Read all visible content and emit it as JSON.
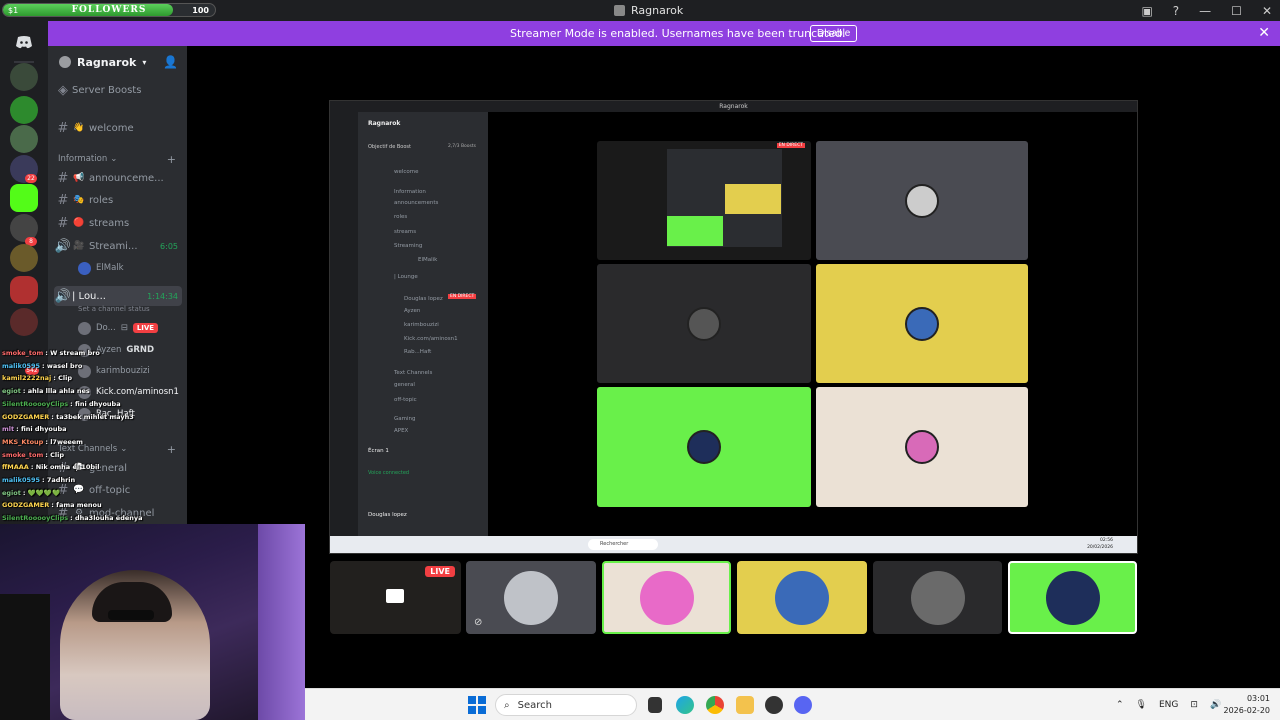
{
  "overlay": {
    "followers_start": "$1",
    "followers_label": "FOLLOWERS",
    "followers_count": "100",
    "followers_progress": 0.8
  },
  "window": {
    "title": "Ragnarok",
    "icons": [
      "mention-icon",
      "help-icon",
      "minimize-icon",
      "maximize-icon",
      "close-icon"
    ]
  },
  "banner": {
    "text": "Streamer Mode is enabled. Usernames have been truncated.",
    "button": "Disable",
    "color": "#8f3fe0"
  },
  "rail": {
    "badges": [
      "22",
      "8",
      "542"
    ]
  },
  "sidebar": {
    "server_name": "Ragnarok",
    "boosts": "Server Boosts",
    "channels": [
      {
        "name": "welcome",
        "emoji": "👋"
      },
      {
        "name": "announceme...",
        "emoji": "📢"
      },
      {
        "name": "roles",
        "emoji": "🎭"
      },
      {
        "name": "streams",
        "emoji": "🔴"
      },
      {
        "name": "Streami...",
        "emoji": "🎥",
        "voice": true,
        "timer": "6:05"
      }
    ],
    "category_info": "Information",
    "streaming_user": "ElMalk",
    "lounge": {
      "name": "| Lou...",
      "timer": "1:14:34",
      "status": "Set a channel status"
    },
    "voice_users": [
      {
        "name": "Do...",
        "live": "LIVE"
      },
      {
        "name": "Ayzen",
        "tag": "GRND"
      },
      {
        "name": "karimbouzizi"
      },
      {
        "name": "Kick.com/aminosn1"
      },
      {
        "name": "Rac..Haft"
      }
    ],
    "category_text": "Text Channels",
    "text_channels": [
      "general",
      "off-topic",
      "mod-channel"
    ]
  },
  "chat": [
    {
      "user": "smoke_tom",
      "text": ": W stream bro",
      "color": "#ff6b6b"
    },
    {
      "user": "malik0595",
      "text": ": wasel bro",
      "color": "#4fc3f7"
    },
    {
      "user": "kamil2222naj",
      "text": ": Clip",
      "color": "#ffd54f"
    },
    {
      "user": "egiot",
      "text": ": ahla llla ahla nes",
      "color": "#81c784"
    },
    {
      "user": "SilentRooooyClips",
      "text": ": fini dhyouba",
      "color": "#4caf50"
    },
    {
      "user": "GODZGAMER",
      "text": ": ta3bek mihlet mayh3",
      "color": "#ffd54f"
    },
    {
      "user": "mlt",
      "text": ": fini dhyouba",
      "color": "#ce93d8"
    },
    {
      "user": "MKS_Ktoup",
      "text": ": l7weeem",
      "color": "#ff8a65"
    },
    {
      "user": "smoke_tom",
      "text": ": Clip",
      "color": "#ff6b6b"
    },
    {
      "user": "ffMAAA",
      "text": ": Nik omha el 10bil",
      "color": "#ffd54f"
    },
    {
      "user": "malik0595",
      "text": ": 7adhrin",
      "color": "#4fc3f7"
    },
    {
      "user": "egiot",
      "text": ": 💚💚💚💚",
      "color": "#81c784"
    },
    {
      "user": "GODZGAMER",
      "text": ": fama menou",
      "color": "#ffd54f"
    },
    {
      "user": "SilentRooooyClips",
      "text": ": dha3louha edenya",
      "color": "#4caf50"
    }
  ],
  "share": {
    "title": "Ragnarok",
    "inner_server": "Ragnarok",
    "inner_boost": "Objectif de Boost",
    "inner_boost_count": "2,7/3 Boosts",
    "inner_rows": [
      "welcome",
      "Information",
      "announcements",
      "roles",
      "streams",
      "Streaming",
      "ElMalik",
      "| Lounge",
      "Douglas lopez",
      "Ayzen",
      "karimbouzizi",
      "Kick.com/aminosn1",
      "Rab...Haft",
      "Text Channels",
      "general",
      "off-topic",
      "Gaming",
      "APEX"
    ],
    "inner_live": "EN DIRECT",
    "inner_screen": "Écran 1",
    "inner_voice": "Voice connected",
    "inner_user": "Douglas lopez",
    "inner_search": "Rechercher",
    "inner_clock": "02:56",
    "inner_date": "20/02/2026"
  },
  "strip": {
    "live": "LIVE"
  },
  "taskbar": {
    "search": "Search",
    "lang": "ENG",
    "time": "03:01",
    "date": "2026-02-20"
  },
  "colors": {
    "tile_green": "#69f04a",
    "tile_yellow": "#e3ce4e",
    "tile_beige": "#ebe1d5",
    "tile_gray": "#4a4b52"
  }
}
